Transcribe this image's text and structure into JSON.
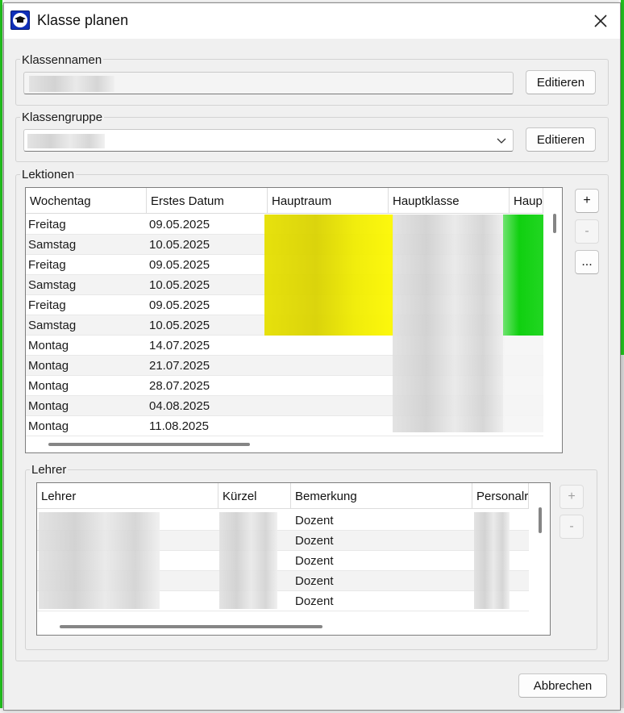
{
  "window": {
    "title": "Klasse planen",
    "close_glyph": "✕"
  },
  "klassennamen": {
    "label": "Klassennamen",
    "edit_label": "Editieren"
  },
  "klassengruppe": {
    "label": "Klassengruppe",
    "edit_label": "Editieren",
    "dropdown_glyph": "⌄"
  },
  "lektionen": {
    "label": "Lektionen",
    "columns": [
      "Wochentag",
      "Erstes Datum",
      "Hauptraum",
      "Hauptklasse",
      "Haup"
    ],
    "rows": [
      {
        "wochentag": "Freitag",
        "datum": "09.05.2025"
      },
      {
        "wochentag": "Samstag",
        "datum": "10.05.2025"
      },
      {
        "wochentag": "Freitag",
        "datum": "09.05.2025"
      },
      {
        "wochentag": "Samstag",
        "datum": "10.05.2025"
      },
      {
        "wochentag": "Freitag",
        "datum": "09.05.2025"
      },
      {
        "wochentag": "Samstag",
        "datum": "10.05.2025"
      },
      {
        "wochentag": "Montag",
        "datum": "14.07.2025"
      },
      {
        "wochentag": "Montag",
        "datum": "21.07.2025"
      },
      {
        "wochentag": "Montag",
        "datum": "28.07.2025"
      },
      {
        "wochentag": "Montag",
        "datum": "04.08.2025"
      },
      {
        "wochentag": "Montag",
        "datum": "11.08.2025"
      }
    ],
    "add_label": "+",
    "remove_label": "-",
    "more_label": "...",
    "highlight_yellow": "#f4f000",
    "highlight_green": "#18d418"
  },
  "lehrer": {
    "label": "Lehrer",
    "columns": [
      "Lehrer",
      "Kürzel",
      "Bemerkung",
      "Personalr"
    ],
    "rows": [
      {
        "bemerkung": "Dozent"
      },
      {
        "bemerkung": "Dozent"
      },
      {
        "bemerkung": "Dozent"
      },
      {
        "bemerkung": "Dozent"
      },
      {
        "bemerkung": "Dozent"
      }
    ],
    "add_label": "+",
    "remove_label": "-"
  },
  "footer": {
    "cancel_label": "Abbrechen"
  }
}
